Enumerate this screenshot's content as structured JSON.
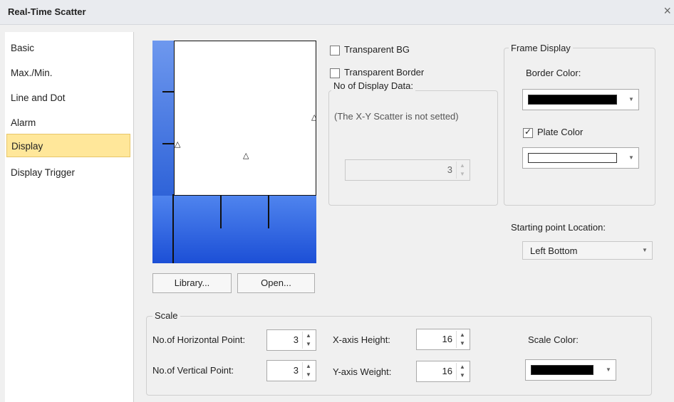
{
  "window": {
    "title": "Real-Time Scatter",
    "close_glyph": "×"
  },
  "nav": {
    "items": [
      {
        "label": "Basic"
      },
      {
        "label": "Max./Min."
      },
      {
        "label": "Line and Dot"
      },
      {
        "label": "Alarm"
      },
      {
        "label": "Display"
      },
      {
        "label": "Display Trigger"
      }
    ],
    "selected": "Display"
  },
  "preview": {
    "marker_glyph": "△"
  },
  "buttons": {
    "library": "Library...",
    "open": "Open..."
  },
  "options": {
    "transparent_bg": {
      "label": "Transparent BG",
      "checked": false
    },
    "transparent_border": {
      "label": "Transparent Border",
      "checked": false
    }
  },
  "display_data": {
    "legend": "No of Display Data:",
    "message": "(The X-Y Scatter is not setted)",
    "value": "3"
  },
  "frame_display": {
    "legend": "Frame Display",
    "border_color_label": "Border Color:",
    "border_color": "#000000",
    "plate_color_label": "Plate Color",
    "plate_color_checked": true,
    "plate_color": "#ffffff"
  },
  "starting_point": {
    "label": "Starting point Location:",
    "value": "Left Bottom"
  },
  "scale": {
    "legend": "Scale",
    "horizontal_label": "No.of Horizontal Point:",
    "horizontal_value": "3",
    "vertical_label": "No.of Vertical Point:",
    "vertical_value": "3",
    "x_height_label": "X-axis Height:",
    "x_height_value": "16",
    "y_weight_label": "Y-axis Weight:",
    "y_weight_value": "16",
    "color_label": "Scale Color:",
    "color": "#000000"
  },
  "colors": {
    "selection": "#ffe79a",
    "preview_blue": "#3a6fe3"
  }
}
